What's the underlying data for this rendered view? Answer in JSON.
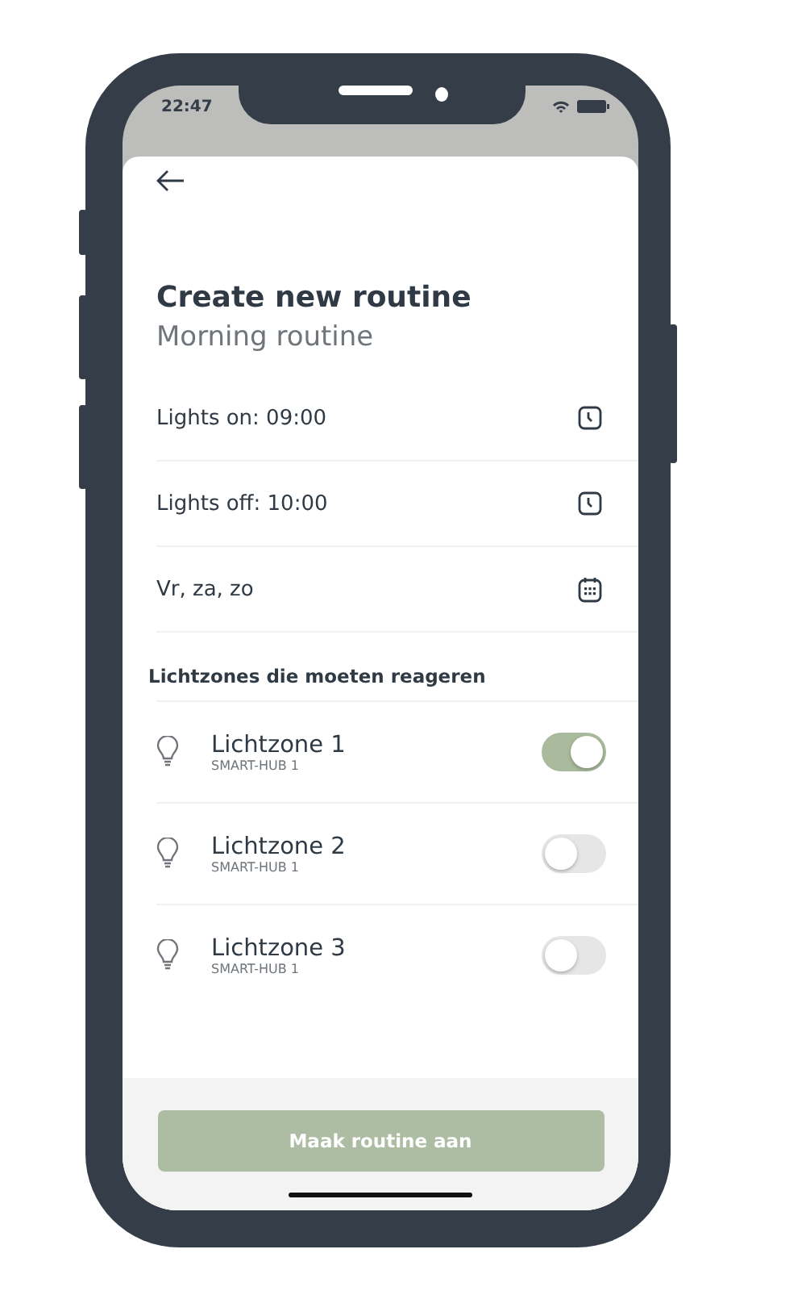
{
  "status_bar": {
    "time": "22:47"
  },
  "header": {
    "title": "Create new routine",
    "subtitle": "Morning routine"
  },
  "schedule": [
    {
      "label": "Lights on: 09:00",
      "kind": "clock"
    },
    {
      "label": "Lights off: 10:00",
      "kind": "clock"
    },
    {
      "label": "Vr, za, zo",
      "kind": "calendar"
    }
  ],
  "zones_section": {
    "title": "Lichtzones die moeten reageren",
    "zones": [
      {
        "name": "Lichtzone 1",
        "hub": "SMART-HUB 1",
        "on": true
      },
      {
        "name": "Lichtzone 2",
        "hub": "SMART-HUB 1",
        "on": false
      },
      {
        "name": "Lichtzone 3",
        "hub": "SMART-HUB 1",
        "on": false
      }
    ]
  },
  "button": {
    "label": "Maak routine aan"
  }
}
